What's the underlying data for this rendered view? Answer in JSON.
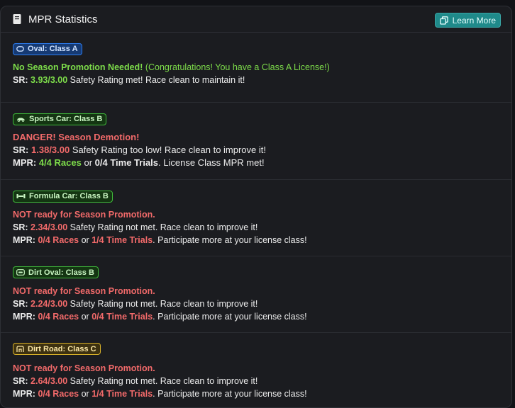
{
  "header": {
    "title": "MPR Statistics",
    "learn_more": "Learn More"
  },
  "sections": [
    {
      "badge": "Oval: Class A",
      "status": "No Season Promotion Needed!",
      "status_note": "(Congratulations! You have a Class A License!)",
      "sr_label": "SR:",
      "sr_value": "3.93/3.00",
      "sr_text": "Safety Rating met! Race clean to maintain it!"
    },
    {
      "badge": "Sports Car: Class B",
      "status": "DANGER! Season Demotion!",
      "sr_label": "SR:",
      "sr_value": "1.38/3.00",
      "sr_text": "Safety Rating too low! Race clean to improve it!",
      "mpr_label": "MPR:",
      "races": "4/4 Races",
      "or": "or",
      "trials": "0/4 Time Trials",
      "mpr_text": ". License Class MPR met!"
    },
    {
      "badge": "Formula Car: Class B",
      "status": "NOT ready for Season Promotion.",
      "sr_label": "SR:",
      "sr_value": "2.34/3.00",
      "sr_text": "Safety Rating not met. Race clean to improve it!",
      "mpr_label": "MPR:",
      "races": "0/4 Races",
      "or": "or",
      "trials": "1/4 Time Trials",
      "mpr_text": ". Participate more at your license class!"
    },
    {
      "badge": "Dirt Oval: Class B",
      "status": "NOT ready for Season Promotion.",
      "sr_label": "SR:",
      "sr_value": "2.24/3.00",
      "sr_text": "Safety Rating not met. Race clean to improve it!",
      "mpr_label": "MPR:",
      "races": "0/4 Races",
      "or": "or",
      "trials": "0/4 Time Trials",
      "mpr_text": ". Participate more at your license class!"
    },
    {
      "badge": "Dirt Road: Class C",
      "status": "NOT ready for Season Promotion.",
      "sr_label": "SR:",
      "sr_value": "2.64/3.00",
      "sr_text": "Safety Rating not met. Race clean to improve it!",
      "mpr_label": "MPR:",
      "races": "0/4 Races",
      "or": "or",
      "trials": "1/4 Time Trials",
      "mpr_text": ". Participate more at your license class!"
    }
  ],
  "colors": {
    "class_a": "#1f66d6",
    "class_b": "#3fb93a",
    "class_c": "#d8b12a",
    "positive": "#7ddc4a",
    "negative": "#f26a6a",
    "accent": "#1f8a8a"
  }
}
